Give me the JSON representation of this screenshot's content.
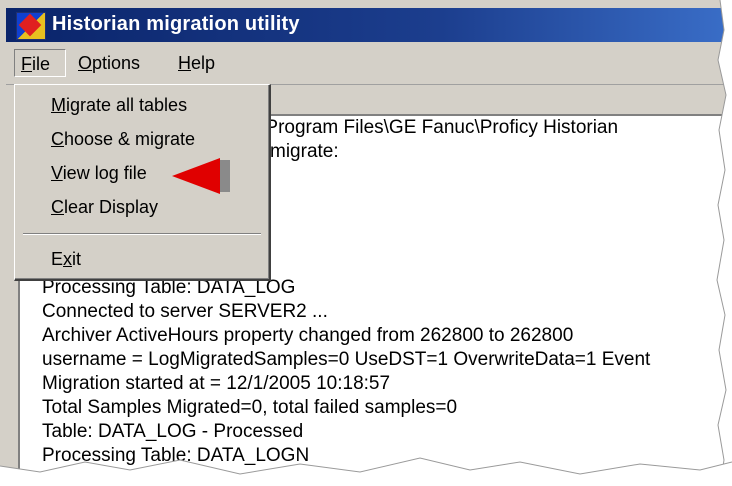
{
  "window": {
    "title": "Historian migration utility",
    "icon": "historian-app-icon"
  },
  "menubar": {
    "file": {
      "label": "File",
      "mnemonic": "F",
      "rest": "ile"
    },
    "options": {
      "label": "Options",
      "mnemonic": "O",
      "rest": "ptions"
    },
    "help": {
      "label": "Help",
      "mnemonic": "H",
      "rest": "elp"
    }
  },
  "file_menu": {
    "items": [
      {
        "label": "Migrate all tables",
        "mnemonic": "M",
        "rest": "igrate all tables"
      },
      {
        "label": "Choose & migrate",
        "mnemonic": "C",
        "rest": "hoose & migrate"
      },
      {
        "label": "View log file",
        "mnemonic": "V",
        "rest": "iew log file"
      },
      {
        "label": "Clear Display",
        "mnemonic": "C",
        "rest": "lear Display"
      },
      {
        "label": "Exit",
        "pre": "E",
        "mnemonic": "x",
        "rest": "it"
      }
    ]
  },
  "log": {
    "lines": [
      "n: C:\\Program Files\\GE Fanuc\\Proficy Historian",
      "migrate:",
      "Processing Table: DATA_LOG",
      "Connected to server SERVER2 ...",
      "Archiver ActiveHours property changed from 262800 to 262800",
      "username =  LogMigratedSamples=0 UseDST=1 OverwriteData=1 Event",
      "Migration started at = 12/1/2005 10:18:57",
      "Total Samples Migrated=0, total failed samples=0",
      "Table: DATA_LOG - Processed",
      "Processing Table: DATA_LOGN"
    ]
  },
  "colors": {
    "titlebar": "#0a246a",
    "face": "#d4d0c8",
    "arrow": "#e00000"
  },
  "annotation": {
    "icon": "red-arrow-icon"
  }
}
